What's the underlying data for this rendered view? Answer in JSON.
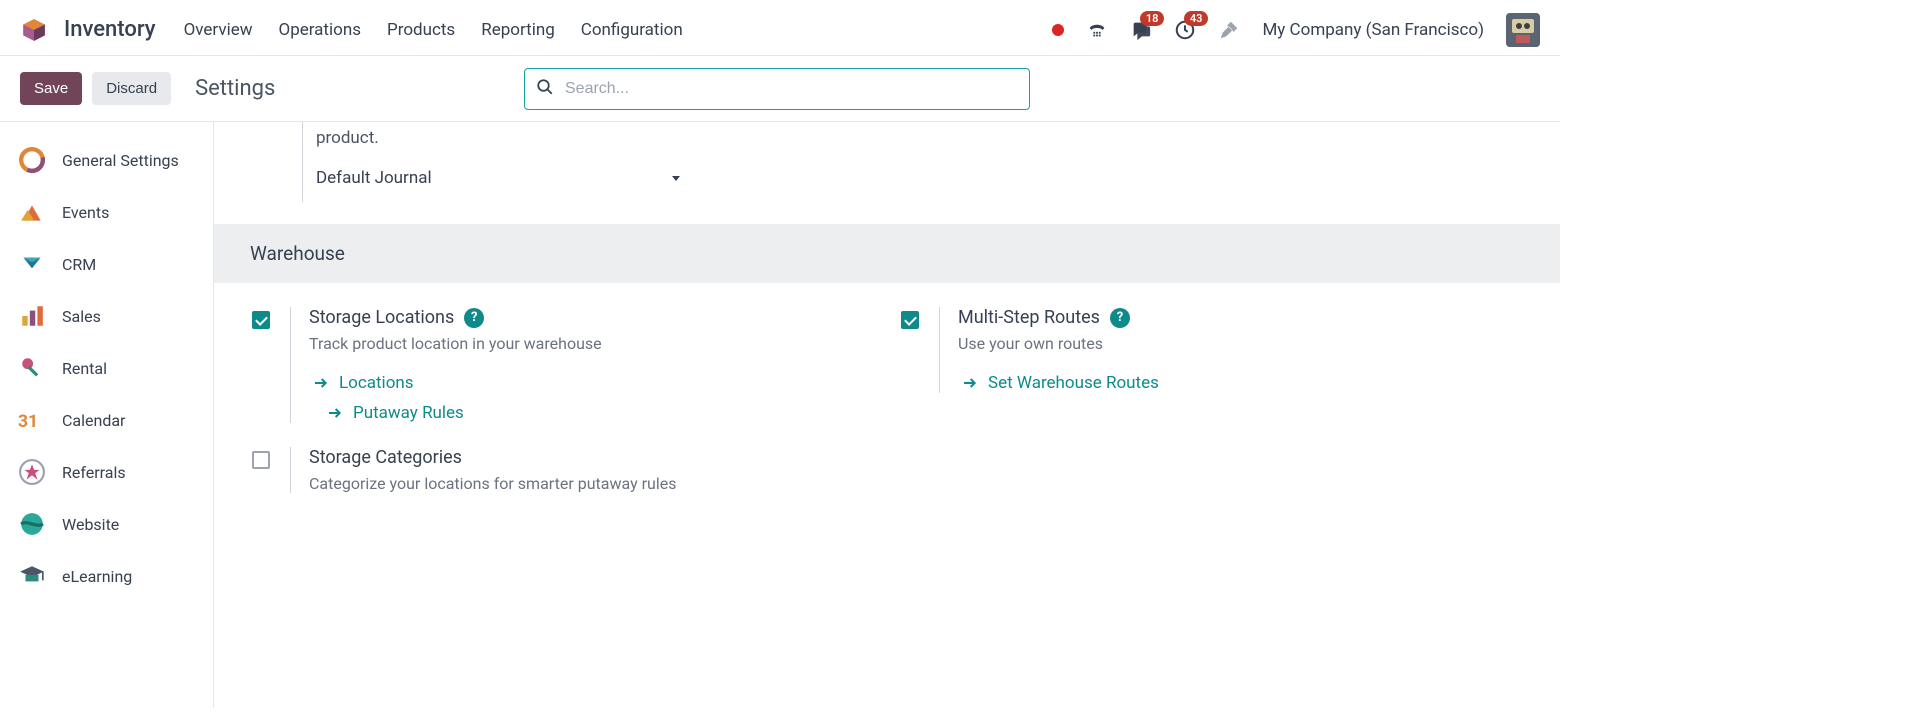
{
  "topbar": {
    "app_title": "Inventory",
    "menu": [
      "Overview",
      "Operations",
      "Products",
      "Reporting",
      "Configuration"
    ],
    "messages_badge": "18",
    "activities_badge": "43",
    "company": "My Company (San Francisco)"
  },
  "controlbar": {
    "save": "Save",
    "discard": "Discard",
    "breadcrumb": "Settings",
    "search_placeholder": "Search..."
  },
  "sidebar": {
    "items": [
      "General Settings",
      "Events",
      "CRM",
      "Sales",
      "Rental",
      "Calendar",
      "Referrals",
      "Website",
      "eLearning"
    ]
  },
  "main": {
    "partial_text": "product.",
    "default_journal_label": "Default Journal",
    "section_title": "Warehouse",
    "storage_locations": {
      "title": "Storage Locations",
      "desc": "Track product location in your warehouse",
      "links": [
        "Locations",
        "Putaway Rules"
      ]
    },
    "multistep_routes": {
      "title": "Multi-Step Routes",
      "desc": "Use your own routes",
      "links": [
        "Set Warehouse Routes"
      ]
    },
    "storage_categories": {
      "title": "Storage Categories",
      "desc": "Categorize your locations for smarter putaway rules"
    }
  }
}
